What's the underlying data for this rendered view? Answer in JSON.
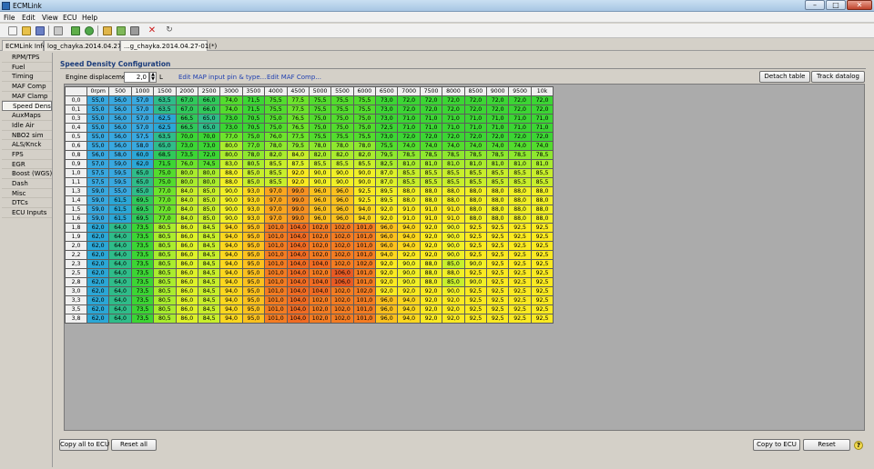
{
  "window": {
    "title": "ECMLink",
    "minimize_glyph": "–",
    "maximize_glyph": "□",
    "close_glyph": "✕"
  },
  "menu": [
    "File",
    "Edit",
    "View",
    "ECU",
    "Help"
  ],
  "toolbar_icons": [
    "new-file-icon",
    "open-folder-icon",
    "save-icon",
    "print-icon",
    "connect-icon",
    "datalog-icon",
    "compare-icon",
    "edit-icon",
    "stop-icon",
    "refresh-icon"
  ],
  "tabs": [
    "ECMLink Info",
    "log_chayka.2014.04.27-01",
    "...g_chayka.2014.04.27-01(*)"
  ],
  "sidebar": [
    "RPM/TPS",
    "Fuel",
    "Timing",
    "MAF Comp",
    "MAF Clamp",
    "Speed Density",
    "AuxMaps",
    "Idle Air",
    "NBO2 sim",
    "ALS/Knck",
    "FPS",
    "EGR",
    "Boost (WGS)",
    "Dash",
    "Misc",
    "DTCs",
    "ECU Inputs"
  ],
  "sidebar_active": 5,
  "section_title": "Speed Density Configuration",
  "engine_displacement": {
    "label": "Engine displacement:",
    "value": "2,0",
    "unit": "L"
  },
  "links": {
    "map_input": "Edit MAP input pin & type...",
    "maf_comp": "Edit MAF Comp..."
  },
  "buttons": {
    "detach": "Detach table",
    "track": "Track datalog",
    "copy_all": "Copy all to ECU",
    "reset_all": "Reset all",
    "copy_ecu": "Copy to ECU",
    "reset": "Reset",
    "help": "?"
  },
  "table": {
    "columns": [
      "0rpm",
      "500",
      "1000",
      "1500",
      "2000",
      "2500",
      "3000",
      "3500",
      "4000",
      "4500",
      "5000",
      "5500",
      "6000",
      "6500",
      "7000",
      "7500",
      "8000",
      "8500",
      "9000",
      "9500",
      "10k"
    ],
    "rows": [
      {
        "label": "0,0",
        "values": [
          "55,0",
          "56,0",
          "57,0",
          "63,5",
          "67,0",
          "66,0",
          "74,0",
          "71,5",
          "75,5",
          "77,5",
          "75,5",
          "75,5",
          "75,5",
          "73,0",
          "72,0",
          "72,0",
          "72,0",
          "72,0",
          "72,0",
          "72,0",
          "72,0"
        ]
      },
      {
        "label": "0,1",
        "values": [
          "55,0",
          "56,0",
          "57,0",
          "63,5",
          "67,0",
          "66,0",
          "74,0",
          "71,5",
          "75,5",
          "77,5",
          "75,5",
          "75,5",
          "75,5",
          "73,0",
          "72,0",
          "72,0",
          "72,0",
          "72,0",
          "72,0",
          "72,0",
          "72,0"
        ]
      },
      {
        "label": "0,3",
        "values": [
          "55,0",
          "56,0",
          "57,0",
          "62,5",
          "66,5",
          "65,0",
          "73,0",
          "70,5",
          "75,0",
          "76,5",
          "75,0",
          "75,0",
          "75,0",
          "73,0",
          "71,0",
          "71,0",
          "71,0",
          "71,0",
          "71,0",
          "71,0",
          "71,0"
        ]
      },
      {
        "label": "0,4",
        "values": [
          "55,0",
          "56,0",
          "57,0",
          "62,5",
          "66,5",
          "65,0",
          "73,0",
          "70,5",
          "75,0",
          "76,5",
          "75,0",
          "75,0",
          "75,0",
          "72,5",
          "71,0",
          "71,0",
          "71,0",
          "71,0",
          "71,0",
          "71,0",
          "71,0"
        ]
      },
      {
        "label": "0,5",
        "values": [
          "55,0",
          "56,0",
          "57,5",
          "63,5",
          "70,0",
          "70,0",
          "77,0",
          "75,0",
          "76,0",
          "77,5",
          "75,5",
          "75,5",
          "75,5",
          "73,0",
          "72,0",
          "72,0",
          "72,0",
          "72,0",
          "72,0",
          "72,0",
          "72,0"
        ]
      },
      {
        "label": "0,6",
        "values": [
          "55,0",
          "56,0",
          "58,0",
          "65,0",
          "73,0",
          "73,0",
          "80,0",
          "77,0",
          "78,0",
          "79,5",
          "78,0",
          "78,0",
          "78,0",
          "75,5",
          "74,0",
          "74,0",
          "74,0",
          "74,0",
          "74,0",
          "74,0",
          "74,0"
        ]
      },
      {
        "label": "0,8",
        "values": [
          "56,0",
          "58,0",
          "60,0",
          "68,5",
          "73,5",
          "72,0",
          "80,0",
          "78,0",
          "82,0",
          "84,0",
          "82,0",
          "82,0",
          "82,0",
          "79,5",
          "78,5",
          "78,5",
          "78,5",
          "78,5",
          "78,5",
          "78,5",
          "78,5"
        ]
      },
      {
        "label": "0,9",
        "values": [
          "57,0",
          "59,0",
          "62,0",
          "71,5",
          "76,0",
          "74,5",
          "83,0",
          "80,5",
          "85,5",
          "87,5",
          "85,5",
          "85,5",
          "85,5",
          "82,5",
          "81,0",
          "81,0",
          "81,0",
          "81,0",
          "81,0",
          "81,0",
          "81,0"
        ]
      },
      {
        "label": "1,0",
        "values": [
          "57,5",
          "59,5",
          "65,0",
          "75,0",
          "80,0",
          "80,0",
          "88,0",
          "85,0",
          "85,5",
          "92,0",
          "90,0",
          "90,0",
          "90,0",
          "87,0",
          "85,5",
          "85,5",
          "85,5",
          "85,5",
          "85,5",
          "85,5",
          "85,5"
        ]
      },
      {
        "label": "1,1",
        "values": [
          "57,5",
          "59,5",
          "65,0",
          "75,0",
          "80,0",
          "80,0",
          "88,0",
          "85,0",
          "85,5",
          "92,0",
          "90,0",
          "90,0",
          "90,0",
          "87,0",
          "85,5",
          "85,5",
          "85,5",
          "85,5",
          "85,5",
          "85,5",
          "85,5"
        ]
      },
      {
        "label": "1,3",
        "values": [
          "59,0",
          "55,0",
          "65,0",
          "77,0",
          "84,0",
          "85,0",
          "90,0",
          "93,0",
          "97,0",
          "99,0",
          "96,0",
          "96,0",
          "92,5",
          "89,5",
          "88,0",
          "88,0",
          "88,0",
          "88,0",
          "88,0",
          "88,0",
          "88,0"
        ]
      },
      {
        "label": "1,4",
        "values": [
          "59,0",
          "61,5",
          "69,5",
          "77,0",
          "84,0",
          "85,0",
          "90,0",
          "93,0",
          "97,0",
          "99,0",
          "96,0",
          "96,0",
          "92,5",
          "89,5",
          "88,0",
          "88,0",
          "88,0",
          "88,0",
          "88,0",
          "88,0",
          "88,0"
        ]
      },
      {
        "label": "1,5",
        "values": [
          "59,0",
          "61,5",
          "69,5",
          "77,0",
          "84,0",
          "85,0",
          "90,0",
          "93,0",
          "97,0",
          "99,0",
          "96,0",
          "96,0",
          "94,0",
          "92,0",
          "91,0",
          "91,0",
          "91,0",
          "88,0",
          "88,0",
          "88,0",
          "88,0"
        ]
      },
      {
        "label": "1,6",
        "values": [
          "59,0",
          "61,5",
          "69,5",
          "77,0",
          "84,0",
          "85,0",
          "90,0",
          "93,0",
          "97,0",
          "99,0",
          "96,0",
          "96,0",
          "94,0",
          "92,0",
          "91,0",
          "91,0",
          "91,0",
          "88,0",
          "88,0",
          "88,0",
          "88,0"
        ]
      },
      {
        "label": "1,8",
        "values": [
          "62,0",
          "64,0",
          "73,5",
          "80,5",
          "86,0",
          "84,5",
          "94,0",
          "95,0",
          "101,0",
          "104,0",
          "102,0",
          "102,0",
          "101,0",
          "96,0",
          "94,0",
          "92,0",
          "90,0",
          "92,5",
          "92,5",
          "92,5",
          "92,5"
        ]
      },
      {
        "label": "1,9",
        "values": [
          "62,0",
          "64,0",
          "73,5",
          "80,5",
          "86,0",
          "84,5",
          "94,0",
          "95,0",
          "101,0",
          "104,0",
          "102,0",
          "102,0",
          "101,0",
          "96,0",
          "94,0",
          "92,0",
          "90,0",
          "92,5",
          "92,5",
          "92,5",
          "92,5"
        ]
      },
      {
        "label": "2,0",
        "values": [
          "62,0",
          "64,0",
          "73,5",
          "80,5",
          "86,0",
          "84,5",
          "94,0",
          "95,0",
          "101,0",
          "104,0",
          "102,0",
          "102,0",
          "101,0",
          "96,0",
          "94,0",
          "92,0",
          "90,0",
          "92,5",
          "92,5",
          "92,5",
          "92,5"
        ]
      },
      {
        "label": "2,2",
        "values": [
          "62,0",
          "64,0",
          "73,5",
          "80,5",
          "86,0",
          "84,5",
          "94,0",
          "95,0",
          "101,0",
          "104,0",
          "102,0",
          "102,0",
          "101,0",
          "94,0",
          "92,0",
          "92,0",
          "90,0",
          "92,5",
          "92,5",
          "92,5",
          "92,5"
        ]
      },
      {
        "label": "2,3",
        "values": [
          "62,0",
          "64,0",
          "73,5",
          "80,5",
          "86,0",
          "84,5",
          "94,0",
          "95,0",
          "101,0",
          "104,0",
          "104,0",
          "102,0",
          "102,0",
          "92,0",
          "90,0",
          "88,0",
          "85,0",
          "90,0",
          "92,5",
          "92,5",
          "92,5"
        ]
      },
      {
        "label": "2,5",
        "values": [
          "62,0",
          "64,0",
          "73,5",
          "80,5",
          "86,0",
          "84,5",
          "94,0",
          "95,0",
          "101,0",
          "104,0",
          "102,0",
          "106,0",
          "101,0",
          "92,0",
          "90,0",
          "88,0",
          "88,0",
          "92,5",
          "92,5",
          "92,5",
          "92,5"
        ]
      },
      {
        "label": "2,8",
        "values": [
          "62,0",
          "64,0",
          "73,5",
          "80,5",
          "86,0",
          "84,5",
          "94,0",
          "95,0",
          "101,0",
          "104,0",
          "104,0",
          "106,0",
          "101,0",
          "92,0",
          "90,0",
          "88,0",
          "85,0",
          "90,0",
          "92,5",
          "92,5",
          "92,5"
        ]
      },
      {
        "label": "3,0",
        "values": [
          "62,0",
          "64,0",
          "73,5",
          "80,5",
          "86,0",
          "84,5",
          "94,0",
          "95,0",
          "101,0",
          "104,0",
          "104,0",
          "102,0",
          "102,0",
          "92,0",
          "92,0",
          "92,0",
          "90,0",
          "92,5",
          "92,5",
          "92,5",
          "92,5"
        ]
      },
      {
        "label": "3,3",
        "values": [
          "62,0",
          "64,0",
          "73,5",
          "80,5",
          "86,0",
          "84,5",
          "94,0",
          "95,0",
          "101,0",
          "104,0",
          "102,0",
          "102,0",
          "101,0",
          "96,0",
          "94,0",
          "92,0",
          "92,0",
          "92,5",
          "92,5",
          "92,5",
          "92,5"
        ]
      },
      {
        "label": "3,5",
        "values": [
          "62,0",
          "64,0",
          "73,5",
          "80,5",
          "86,0",
          "84,5",
          "94,0",
          "95,0",
          "101,0",
          "104,0",
          "102,0",
          "102,0",
          "101,0",
          "96,0",
          "94,0",
          "92,0",
          "92,0",
          "92,5",
          "92,5",
          "92,5",
          "92,5"
        ]
      },
      {
        "label": "3,8",
        "values": [
          "62,0",
          "64,0",
          "73,5",
          "80,5",
          "86,0",
          "84,5",
          "94,0",
          "95,0",
          "101,0",
          "104,0",
          "102,0",
          "102,0",
          "101,0",
          "96,0",
          "94,0",
          "92,0",
          "92,0",
          "92,5",
          "92,5",
          "92,5",
          "92,5"
        ]
      }
    ]
  }
}
